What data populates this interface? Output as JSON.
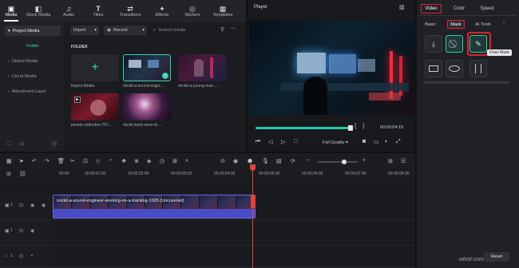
{
  "toolbar": {
    "items": [
      {
        "label": "Media",
        "icon": "media-icon"
      },
      {
        "label": "Stock Media",
        "icon": "stock-media-icon"
      },
      {
        "label": "Audio",
        "icon": "audio-icon"
      },
      {
        "label": "Titles",
        "icon": "titles-icon"
      },
      {
        "label": "Transitions",
        "icon": "transitions-icon"
      },
      {
        "label": "Effects",
        "icon": "effects-icon"
      },
      {
        "label": "Stickers",
        "icon": "stickers-icon"
      },
      {
        "label": "Templates",
        "icon": "templates-icon"
      }
    ]
  },
  "sidebar": {
    "items": [
      {
        "label": "Project Media",
        "selected": true
      },
      {
        "label": "Folder",
        "selected": false
      },
      {
        "label": "Global Media",
        "selected": false
      },
      {
        "label": "Cloud Media",
        "selected": false
      },
      {
        "label": "Adjustment Layer",
        "selected": false
      }
    ]
  },
  "media": {
    "import_dropdown": "Import",
    "record_dropdown": "Record",
    "search_placeholder": "Search media",
    "folder_label": "FOLDER",
    "items": [
      {
        "label": "Import Media"
      },
      {
        "label": "mickit-a-sound-engin..."
      },
      {
        "label": "mickit-a-young-man-..."
      },
      {
        "label": "pexels-cottonbro-797..."
      },
      {
        "label": "mickit-back-view-of-..."
      }
    ]
  },
  "player": {
    "title": "Player",
    "timecode": "00:00:04:15",
    "quality": "Full Quality",
    "progress": 1.0
  },
  "properties": {
    "tabs": [
      "Video",
      "Color",
      "Speed"
    ],
    "selected_tab": "Video",
    "subtabs": [
      "Basic",
      "Mask",
      "AI Tools"
    ],
    "selected_subtab": "Mask",
    "tooltip": "Draw Mask",
    "reset_label": "Reset",
    "watermark": "wlvid.com"
  },
  "timeline": {
    "ruler": [
      "00:00",
      "00:00:01:00",
      "00:00:02:00",
      "00:00:03:00",
      "00:00:04:00",
      "00:00:05:00",
      "00:00:06:00",
      "00:00:07:00",
      "00:00:08:00"
    ],
    "clip_name": "mickit-a-sound-engineer-working-on-a-tracking-1005 (Uncovered)",
    "tracks": [
      "2",
      "1",
      "1"
    ]
  },
  "colors": {
    "accent": "#28c7a6",
    "highlight_box": "#e0222d",
    "clip": "#4a4dc6",
    "playhead": "#e2433a"
  }
}
